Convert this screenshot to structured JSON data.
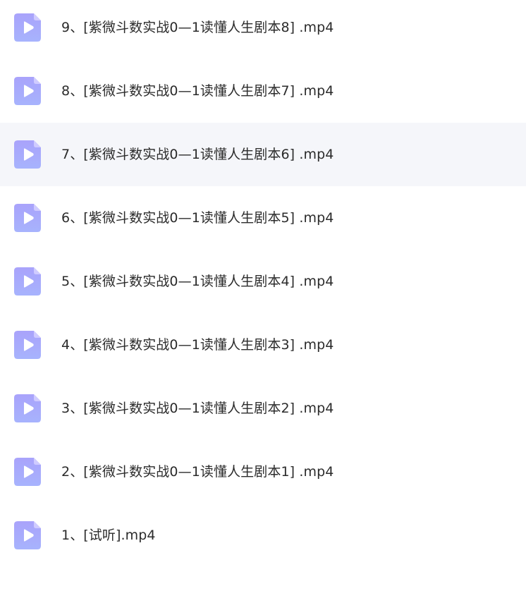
{
  "files": [
    {
      "name": "9、[紫微斗数实战0—1读懂人生剧本8] .mp4",
      "icon": "video-file-icon",
      "highlighted": false
    },
    {
      "name": "8、[紫微斗数实战0—1读懂人生剧本7] .mp4",
      "icon": "video-file-icon",
      "highlighted": false
    },
    {
      "name": "7、[紫微斗数实战0—1读懂人生剧本6] .mp4",
      "icon": "video-file-icon",
      "highlighted": true
    },
    {
      "name": "6、[紫微斗数实战0—1读懂人生剧本5] .mp4",
      "icon": "video-file-icon",
      "highlighted": false
    },
    {
      "name": "5、[紫微斗数实战0—1读懂人生剧本4] .mp4",
      "icon": "video-file-icon",
      "highlighted": false
    },
    {
      "name": "4、[紫微斗数实战0—1读懂人生剧本3] .mp4",
      "icon": "video-file-icon",
      "highlighted": false
    },
    {
      "name": "3、[紫微斗数实战0—1读懂人生剧本2] .mp4",
      "icon": "video-file-icon",
      "highlighted": false
    },
    {
      "name": "2、[紫微斗数实战0—1读懂人生剧本1] .mp4",
      "icon": "video-file-icon",
      "highlighted": false
    },
    {
      "name": "1、[试听].mp4",
      "icon": "video-file-icon",
      "highlighted": false
    }
  ],
  "colors": {
    "icon_top": "#a9a3fb",
    "icon_bottom": "#a7b3fd",
    "icon_fold": "#cfcbff",
    "play": "#ffffff",
    "highlight_bg": "#f5f6fa",
    "text": "#2b2b2b"
  }
}
